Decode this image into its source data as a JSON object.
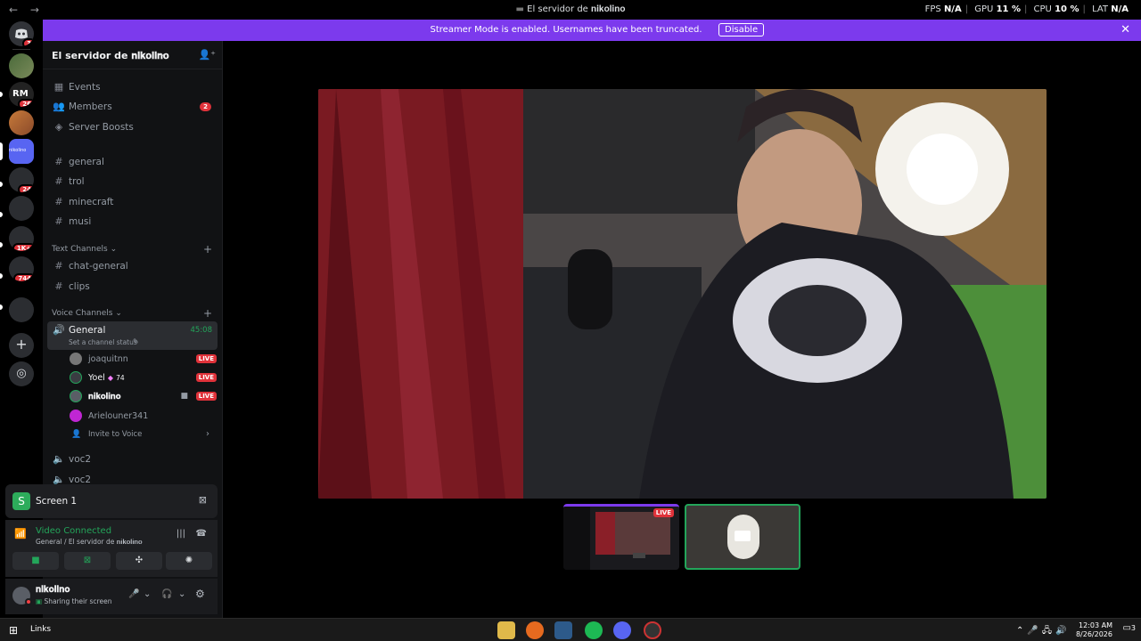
{
  "titlebar": {
    "back": "←",
    "forward": "→",
    "title": "El servidor de 𝐧𝐢𝐤𝐨𝐥𝐢𝐧𝐨",
    "fps_label": "FPS",
    "fps_value": "N/A",
    "gpu_label": "GPU",
    "gpu_value": "11 %",
    "cpu_label": "CPU",
    "cpu_value": "10 %",
    "lat_label": "LAT",
    "lat_value": "N/A"
  },
  "rail": {
    "home_badge": "3",
    "servers": [
      {
        "label": "",
        "badge": ""
      },
      {
        "label": "RM",
        "badge": "26"
      },
      {
        "label": "",
        "badge": ""
      },
      {
        "label": "nikolino",
        "badge": ""
      },
      {
        "label": "",
        "badge": "24"
      },
      {
        "label": "",
        "badge": ""
      },
      {
        "label": "",
        "badge": "1K+"
      },
      {
        "label": "",
        "badge": "744"
      },
      {
        "label": "",
        "badge": ""
      }
    ]
  },
  "banner": {
    "message": "Streamer Mode is enabled. Usernames have been truncated.",
    "disable_label": "Disable"
  },
  "server": {
    "name": "El servidor de 𝐧𝐢𝐤𝐨𝐥𝐢𝐧𝐨"
  },
  "menu": [
    {
      "label": "Events",
      "count": ""
    },
    {
      "label": "Members",
      "count": "2"
    },
    {
      "label": "Server Boosts",
      "count": ""
    }
  ],
  "top_channels": [
    "general",
    "trol",
    "minecraft",
    "musi"
  ],
  "text_category": "Text Channels",
  "text_channels": [
    "chat-general",
    "clips"
  ],
  "voice_category": "Voice Channels",
  "active_voice": {
    "name": "General",
    "time": "45:08",
    "status": "Set a channel status"
  },
  "voice_users": [
    {
      "name": "joaquitnn",
      "live": "LIVE",
      "extra": ""
    },
    {
      "name": "Yoel",
      "live": "LIVE",
      "extra": "74"
    },
    {
      "name": "𝐧𝐢𝐤𝐨𝐥𝐢𝐧𝐨",
      "live": "LIVE",
      "extra": ""
    },
    {
      "name": "Arielouner341",
      "live": "",
      "extra": ""
    }
  ],
  "invite_voice": "Invite to Voice",
  "other_voice": [
    "voc2",
    "voc2"
  ],
  "screen_share": {
    "label": "Screen 1"
  },
  "voice_connected": {
    "title": "Video Connected",
    "subtitle": "General / El servidor de 𝐧𝐢𝐤𝐨𝐥𝐢𝐧𝐨"
  },
  "account": {
    "name": "𝐧𝐢𝐤𝐨𝐥𝐢𝐧𝐨",
    "status": "Sharing their screen"
  },
  "stream_tile": {
    "live": "LIVE"
  },
  "taskbar": {
    "links": "Links",
    "time": "12:03 AM",
    "date": "8/26/2026",
    "notifications": "3"
  },
  "colors": {
    "accent": "#7c3aed",
    "live": "#e0323a",
    "connected": "#23a55a"
  }
}
